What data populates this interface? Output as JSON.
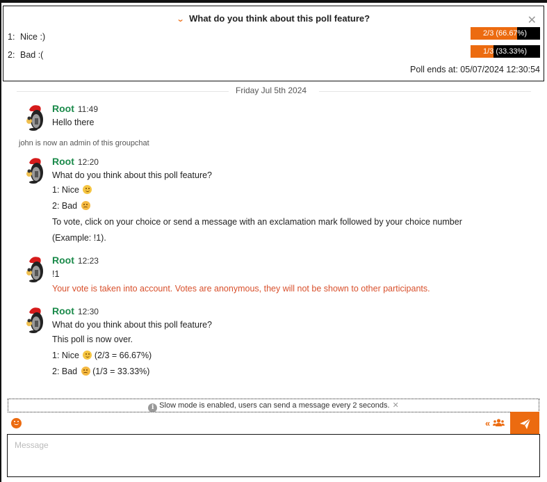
{
  "poll": {
    "title": "What do you think about this poll feature?",
    "collapse_icon": "chevron-down-icon",
    "close_icon": "close-icon",
    "choices": [
      {
        "number": "1:",
        "label": "Nice :)",
        "votes": 2,
        "total": 3,
        "percent": 66.67,
        "bar_label": "2/3 (66.67%)"
      },
      {
        "number": "2:",
        "label": "Bad :(",
        "votes": 1,
        "total": 3,
        "percent": 33.33,
        "bar_label": "1/3 (33.33%)"
      }
    ],
    "ends_label": "Poll ends at: 05/07/2024 12:30:54"
  },
  "date_divider": "Friday Jul 5th 2024",
  "messages": [
    {
      "author": "Root",
      "time": "11:49",
      "lines": [
        "Hello there"
      ]
    },
    {
      "author": "Root",
      "time": "12:20",
      "lines": [
        "What do you think about this poll feature?",
        "1: Nice",
        "2: Bad",
        "To vote, click on your choice or send a message with an exclamation mark followed by your choice number",
        "(Example: !1)."
      ]
    },
    {
      "author": "Root",
      "time": "12:23",
      "lines": [
        "!1",
        "Your vote is taken into account. Votes are anonymous, they will not be shown to other participants."
      ]
    },
    {
      "author": "Root",
      "time": "12:30",
      "lines": [
        "What do you think about this poll feature?",
        "This poll is now over.",
        "1: Nice",
        "(2/3 = 66.67%)",
        "2: Bad",
        "(1/3 = 33.33%)"
      ]
    }
  ],
  "system_message": "john is now an admin of this groupchat",
  "slow_mode": "Slow mode is enabled, users can send a message every 2 seconds.",
  "composer": {
    "placeholder": "Message",
    "value": ""
  },
  "colors": {
    "accent": "#ec6b10",
    "author": "#1a8a4a",
    "warning": "#d8502c"
  }
}
